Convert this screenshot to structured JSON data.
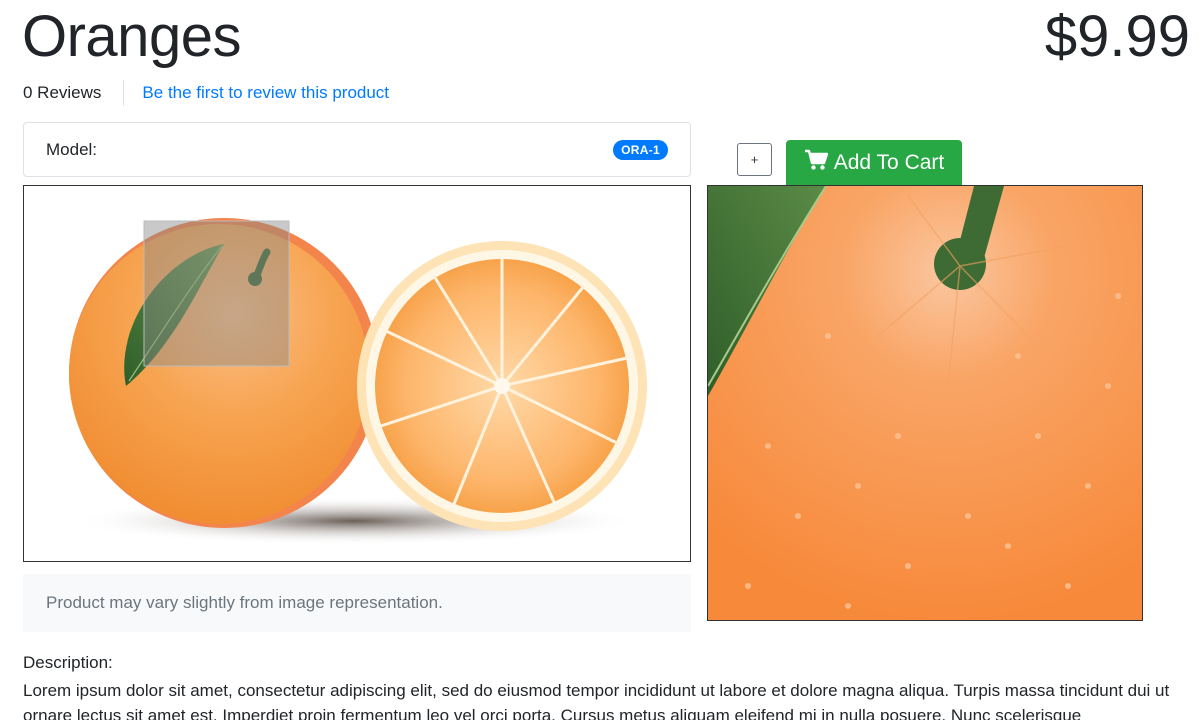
{
  "product": {
    "title": "Oranges",
    "price": "$9.99",
    "reviews_count": "0 Reviews",
    "review_link": "Be the first to review this product",
    "model_label": "Model:",
    "model_code": "ORA-1"
  },
  "actions": {
    "plus_label": "+",
    "add_to_cart_label": "Add To Cart"
  },
  "image": {
    "caption": "Product may vary slightly from image representation."
  },
  "description": {
    "label": "Description:",
    "text": "Lorem ipsum dolor sit amet, consectetur adipiscing elit, sed do eiusmod tempor incididunt ut labore et dolore magna aliqua. Turpis massa tincidunt dui ut ornare lectus sit amet est. Imperdiet proin fermentum leo vel orci porta. Cursus metus aliquam eleifend mi in nulla posuere. Nunc scelerisque"
  },
  "colors": {
    "link": "#007bff",
    "badge": "#007bff",
    "cart_button": "#28a745",
    "orange": "#f7893a"
  },
  "icons": [
    "cart-icon",
    "plus-icon"
  ]
}
